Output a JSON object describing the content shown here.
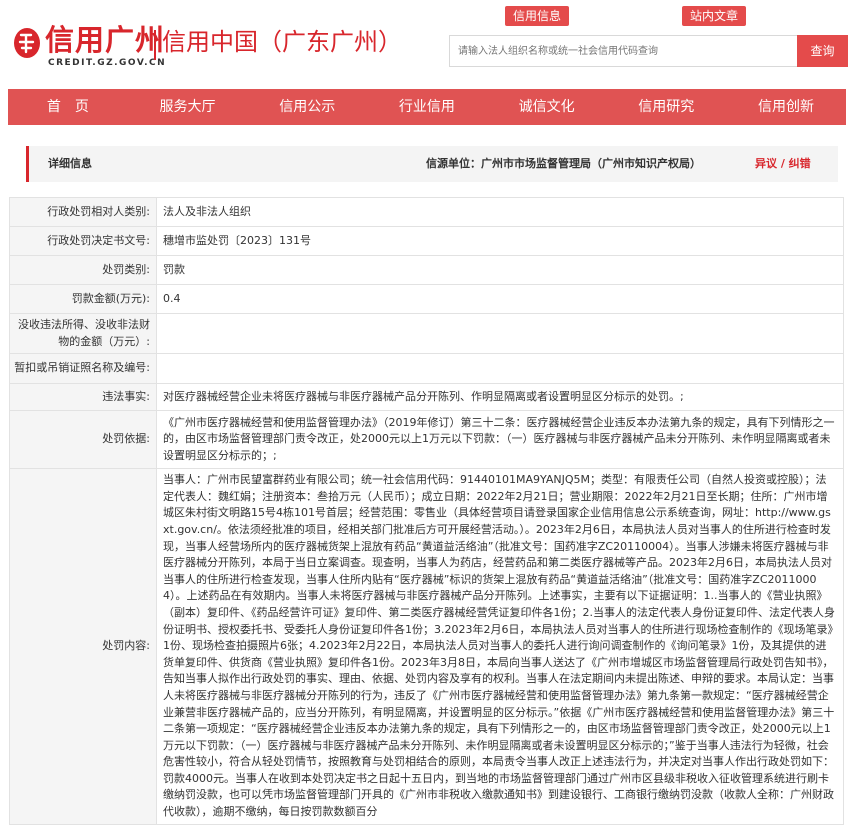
{
  "header": {
    "logo_text": "信用广州",
    "logo_domain": "CREDIT.GZ.GOV.CN",
    "site_name": "信用中国（广东广州）",
    "top_links": [
      "信用信息",
      "站内文章"
    ],
    "search_placeholder": "请输入法人组织名称或统一社会信用代码查询",
    "search_button": "查询"
  },
  "nav": {
    "items": [
      "首　页",
      "服务大厅",
      "信用公示",
      "行业信用",
      "诚信文化",
      "信用研究",
      "信用创新"
    ]
  },
  "detail": {
    "title": "详细信息",
    "source": "信源单位：广州市市场监督管理局（广州市知识产权局）",
    "objection": "异议 / 纠错"
  },
  "rows": [
    {
      "label": "行政处罚相对人类别:",
      "value": "法人及非法人组织"
    },
    {
      "label": "行政处罚决定书文号:",
      "value": "穗增市监处罚〔2023〕131号"
    },
    {
      "label": "处罚类别:",
      "value": "罚款"
    },
    {
      "label": "罚款金额(万元):",
      "value": "0.4"
    },
    {
      "label": "没收违法所得、没收非法财物的金额（万元）:",
      "value": ""
    },
    {
      "label": "暂扣或吊销证照名称及编号:",
      "value": ""
    },
    {
      "label": "违法事实:",
      "value": "对医疗器械经营企业未将医疗器械与非医疗器械产品分开陈列、作明显隔离或者设置明显区分标示的处罚。;"
    },
    {
      "label": "处罚依据:",
      "value": "《广州市医疗器械经营和使用监督管理办法》（2019年修订）第三十二条：医疗器械经营企业违反本办法第九条的规定，具有下列情形之一的，由区市场监督管理部门责令改正，处2000元以上1万元以下罚款：（一）医疗器械与非医疗器械产品未分开陈列、未作明显隔离或者未设置明显区分标示的；;"
    },
    {
      "label": "处罚内容:",
      "value": "当事人：广州市民望富群药业有限公司；统一社会信用代码：91440101MA9YANJQ5M；类型：有限责任公司（自然人投资或控股）；法定代表人：魏红娟；注册资本：叁拾万元（人民币）；成立日期：2022年2月21日；营业期限：2022年2月21日至长期；住所：广州市增城区朱村街文明路15号4栋101号首层；经营范围：零售业（具体经营项目请登录国家企业信用信息公示系统查询，网址：http://www.gsxt.gov.cn/。依法须经批准的项目，经相关部门批准后方可开展经营活动。）。2023年2月6日，本局执法人员对当事人的住所进行检查时发现，当事人经营场所内的医疗器械货架上混放有药品“黄道益活络油”（批准文号：国药准字ZC20110004）。当事人涉嫌未将医疗器械与非医疗器械分开陈列，本局于当日立案调查。现查明，当事人为药店，经营药品和第二类医疗器械等产品。2023年2月6日，本局执法人员对当事人的住所进行检查发现，当事人住所内贴有“医疗器械”标识的货架上混放有药品“黄道益活络油”（批准文号：国药准字ZC20110004）。上述药品在有效期内。当事人未将医疗器械与非医疗器械产品分开陈列。上述事实，主要有以下证据证明：1..当事人的《营业执照》（副本）复印件、《药品经营许可证》复印件、第二类医疗器械经营凭证复印件各1份；2.当事人的法定代表人身份证复印件、法定代表人身份证明书、授权委托书、受委托人身份证复印件各1份；3.2023年2月6日，本局执法人员对当事人的住所进行现场检查制作的《现场笔录》1份、现场检查拍摄照片6张；4.2023年2月22日，本局执法人员对当事人的委托人进行询问调查制作的《询问笔录》1份，及其提供的进货单复印件、供货商《营业执照》复印件各1份。2023年3月8日，本局向当事人送达了《广州市增城区市场监督管理局行政处罚告知书》，告知当事人拟作出行政处罚的事实、理由、依据、处罚内容及享有的权利。当事人在法定期间内未提出陈述、申辩的要求。本局认定：当事人未将医疗器械与非医疗器械分开陈列的行为，违反了《广州市医疗器械经营和使用监督管理办法》第九条第一款规定：“医疗器械经营企业兼营非医疗器械产品的，应当分开陈列，有明显隔离，并设置明显的区分标示。”依据《广州市医疗器械经营和使用监督管理办法》第三十二条第一项规定：“医疗器械经营企业违反本办法第九条的规定，具有下列情形之一的，由区市场监督管理部门责令改正，处2000元以上1万元以下罚款：（一）医疗器械与非医疗器械产品未分开陈列、未作明显隔离或者未设置明显区分标示的；”鉴于当事人违法行为轻微，社会危害性较小，符合从轻处罚情节，按照教育与处罚相结合的原则，本局责令当事人改正上述违法行为，并决定对当事人作出行政处罚如下：罚款4000元。当事人在收到本处罚决定书之日起十五日内，到当地的市场监督管理部门通过广州市区县级非税收入征收管理系统进行刷卡缴纳罚没款，也可以凭市场监督管理部门开具的《广州市非税收入缴款通知书》到建设银行、工商银行缴纳罚没款（收款人全称：广州财政代收款），逾期不缴纳，每日按罚款数额百分"
    }
  ],
  "colors": {
    "brand_red": "#d8262c",
    "nav_red": "#e05353",
    "label_bg": "#f5f5f5"
  }
}
